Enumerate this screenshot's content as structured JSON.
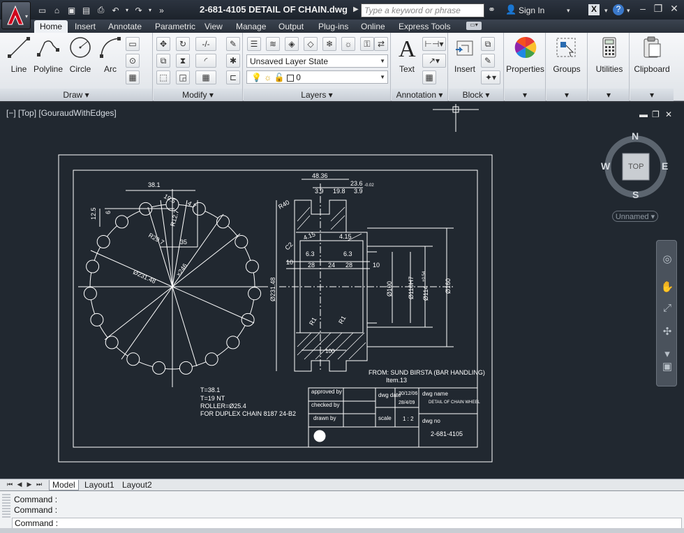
{
  "title_bar": {
    "file_title": "2-681-4105 DETAIL OF CHAIN.dwg",
    "search_placeholder": "Type a keyword or phrase",
    "sign_in": "Sign In"
  },
  "ribbon_tabs": [
    "Home",
    "Insert",
    "Annotate",
    "Parametric",
    "View",
    "Manage",
    "Output",
    "Plug-ins",
    "Online",
    "Express Tools"
  ],
  "ribbon": {
    "draw": {
      "title": "Draw",
      "tools": [
        "Line",
        "Polyline",
        "Circle",
        "Arc"
      ]
    },
    "modify": {
      "title": "Modify"
    },
    "layers": {
      "title": "Layers",
      "layer_state": "Unsaved Layer State",
      "current_layer": "0"
    },
    "annotation": {
      "title": "Annotation",
      "text": "Text"
    },
    "block": {
      "title": "Block",
      "insert": "Insert"
    },
    "properties": "Properties",
    "groups": "Groups",
    "utilities": "Utilities",
    "clipboard": "Clipboard"
  },
  "viewport": {
    "label": "[−] [Top] [GouraudWithEdges]",
    "viewcube": {
      "n": "N",
      "s": "S",
      "e": "E",
      "w": "W",
      "face": "TOP"
    },
    "ucs_name": "Unnamed"
  },
  "drawing": {
    "dims": {
      "d48": "48.36",
      "d23": "23.6",
      "d23sub": "-0.02",
      "d39a": "3.9",
      "d198": "19.8",
      "d39b": "3.9",
      "r40": "R40",
      "c2": "C2",
      "d415a": "4.15",
      "d415b": "4.15",
      "d63a": "6.3",
      "d63b": "6.3",
      "d10a": "10",
      "d10b": "10",
      "d28a": "28",
      "d24": "24",
      "d28b": "28",
      "dia231": "Ø231.48",
      "dia100": "Ø100",
      "dia110": "Ø110H7",
      "dia114": "Ø114",
      "dia114tol": "+0.54",
      "dia160": "Ø160",
      "r1a": "R1",
      "r1b": "R1",
      "d100": "100",
      "s381": "38.1",
      "s125": "12.5",
      "s6": "6",
      "s195": "19.5",
      "s47": "4.7",
      "r127": "R12.7",
      "r297": "R29.7",
      "s35": "35",
      "s2314": "Ø231.48",
      "s2446": "×246"
    },
    "notes": [
      "T=38.1",
      "T=19 NT",
      "ROLLER=Ø25.4",
      "FOR DUPLEX CHAIN 8187 24-B2"
    ],
    "from_line": "FROM: SUND BIRSTA (BAR HANDLING)",
    "from_label": "FROM:",
    "from_text": "SUND BIRSTA (BAR HANDLING)",
    "item": "Item.13",
    "title_block": {
      "approved_by": "approved by",
      "checked_by": "checked by",
      "drawn_by": "drawn by",
      "dwg_date_label": "dwg date",
      "date1": "30/12/06",
      "date2": "28/4/09",
      "scale_label": "scale",
      "scale": "1 : 2",
      "dwg_name_label": "dwg name",
      "dwg_name": "DETAIL OF CHAIN WHEEL",
      "dwg_no_label": "dwg no",
      "dwg_no": "2-681-4105"
    }
  },
  "layout_tabs": [
    "Model",
    "Layout1",
    "Layout2"
  ],
  "command_lines": [
    "Command :",
    "Command :",
    "Command :"
  ],
  "colors": {
    "canvas": "#212830",
    "line": "#ffffff",
    "ribbon": "#e6e9ed",
    "accent_red": "#c8102e"
  }
}
